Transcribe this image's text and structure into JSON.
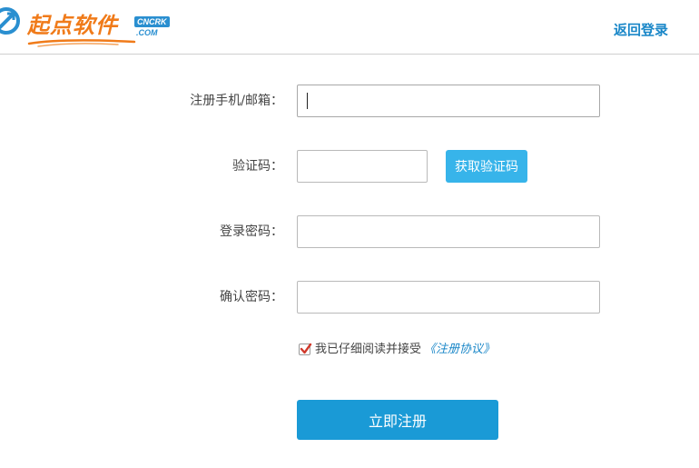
{
  "header": {
    "logo": {
      "text": "起点软件",
      "badge_top": "CNCRK",
      "badge_bottom": ".COM",
      "mark_icon": "circular-arrow-logo-icon"
    },
    "back_login_label": "返回登录"
  },
  "form": {
    "account": {
      "label": "注册手机/邮箱：",
      "value": "",
      "placeholder": ""
    },
    "code": {
      "label": "验证码：",
      "value": "",
      "placeholder": "",
      "button_label": "获取验证码"
    },
    "password": {
      "label": "登录密码：",
      "value": "",
      "placeholder": ""
    },
    "confirm": {
      "label": "确认密码：",
      "value": "",
      "placeholder": ""
    },
    "agreement": {
      "checked": true,
      "text": "我已仔细阅读并接受",
      "link_label": "《注册协议》"
    },
    "submit_label": "立即注册"
  },
  "colors": {
    "brand_orange": "#f07b1a",
    "brand_blue": "#1a87c8",
    "button_light_blue": "#37b4ea",
    "button_blue": "#1a9ad6",
    "checkbox_check": "#d0392b"
  }
}
